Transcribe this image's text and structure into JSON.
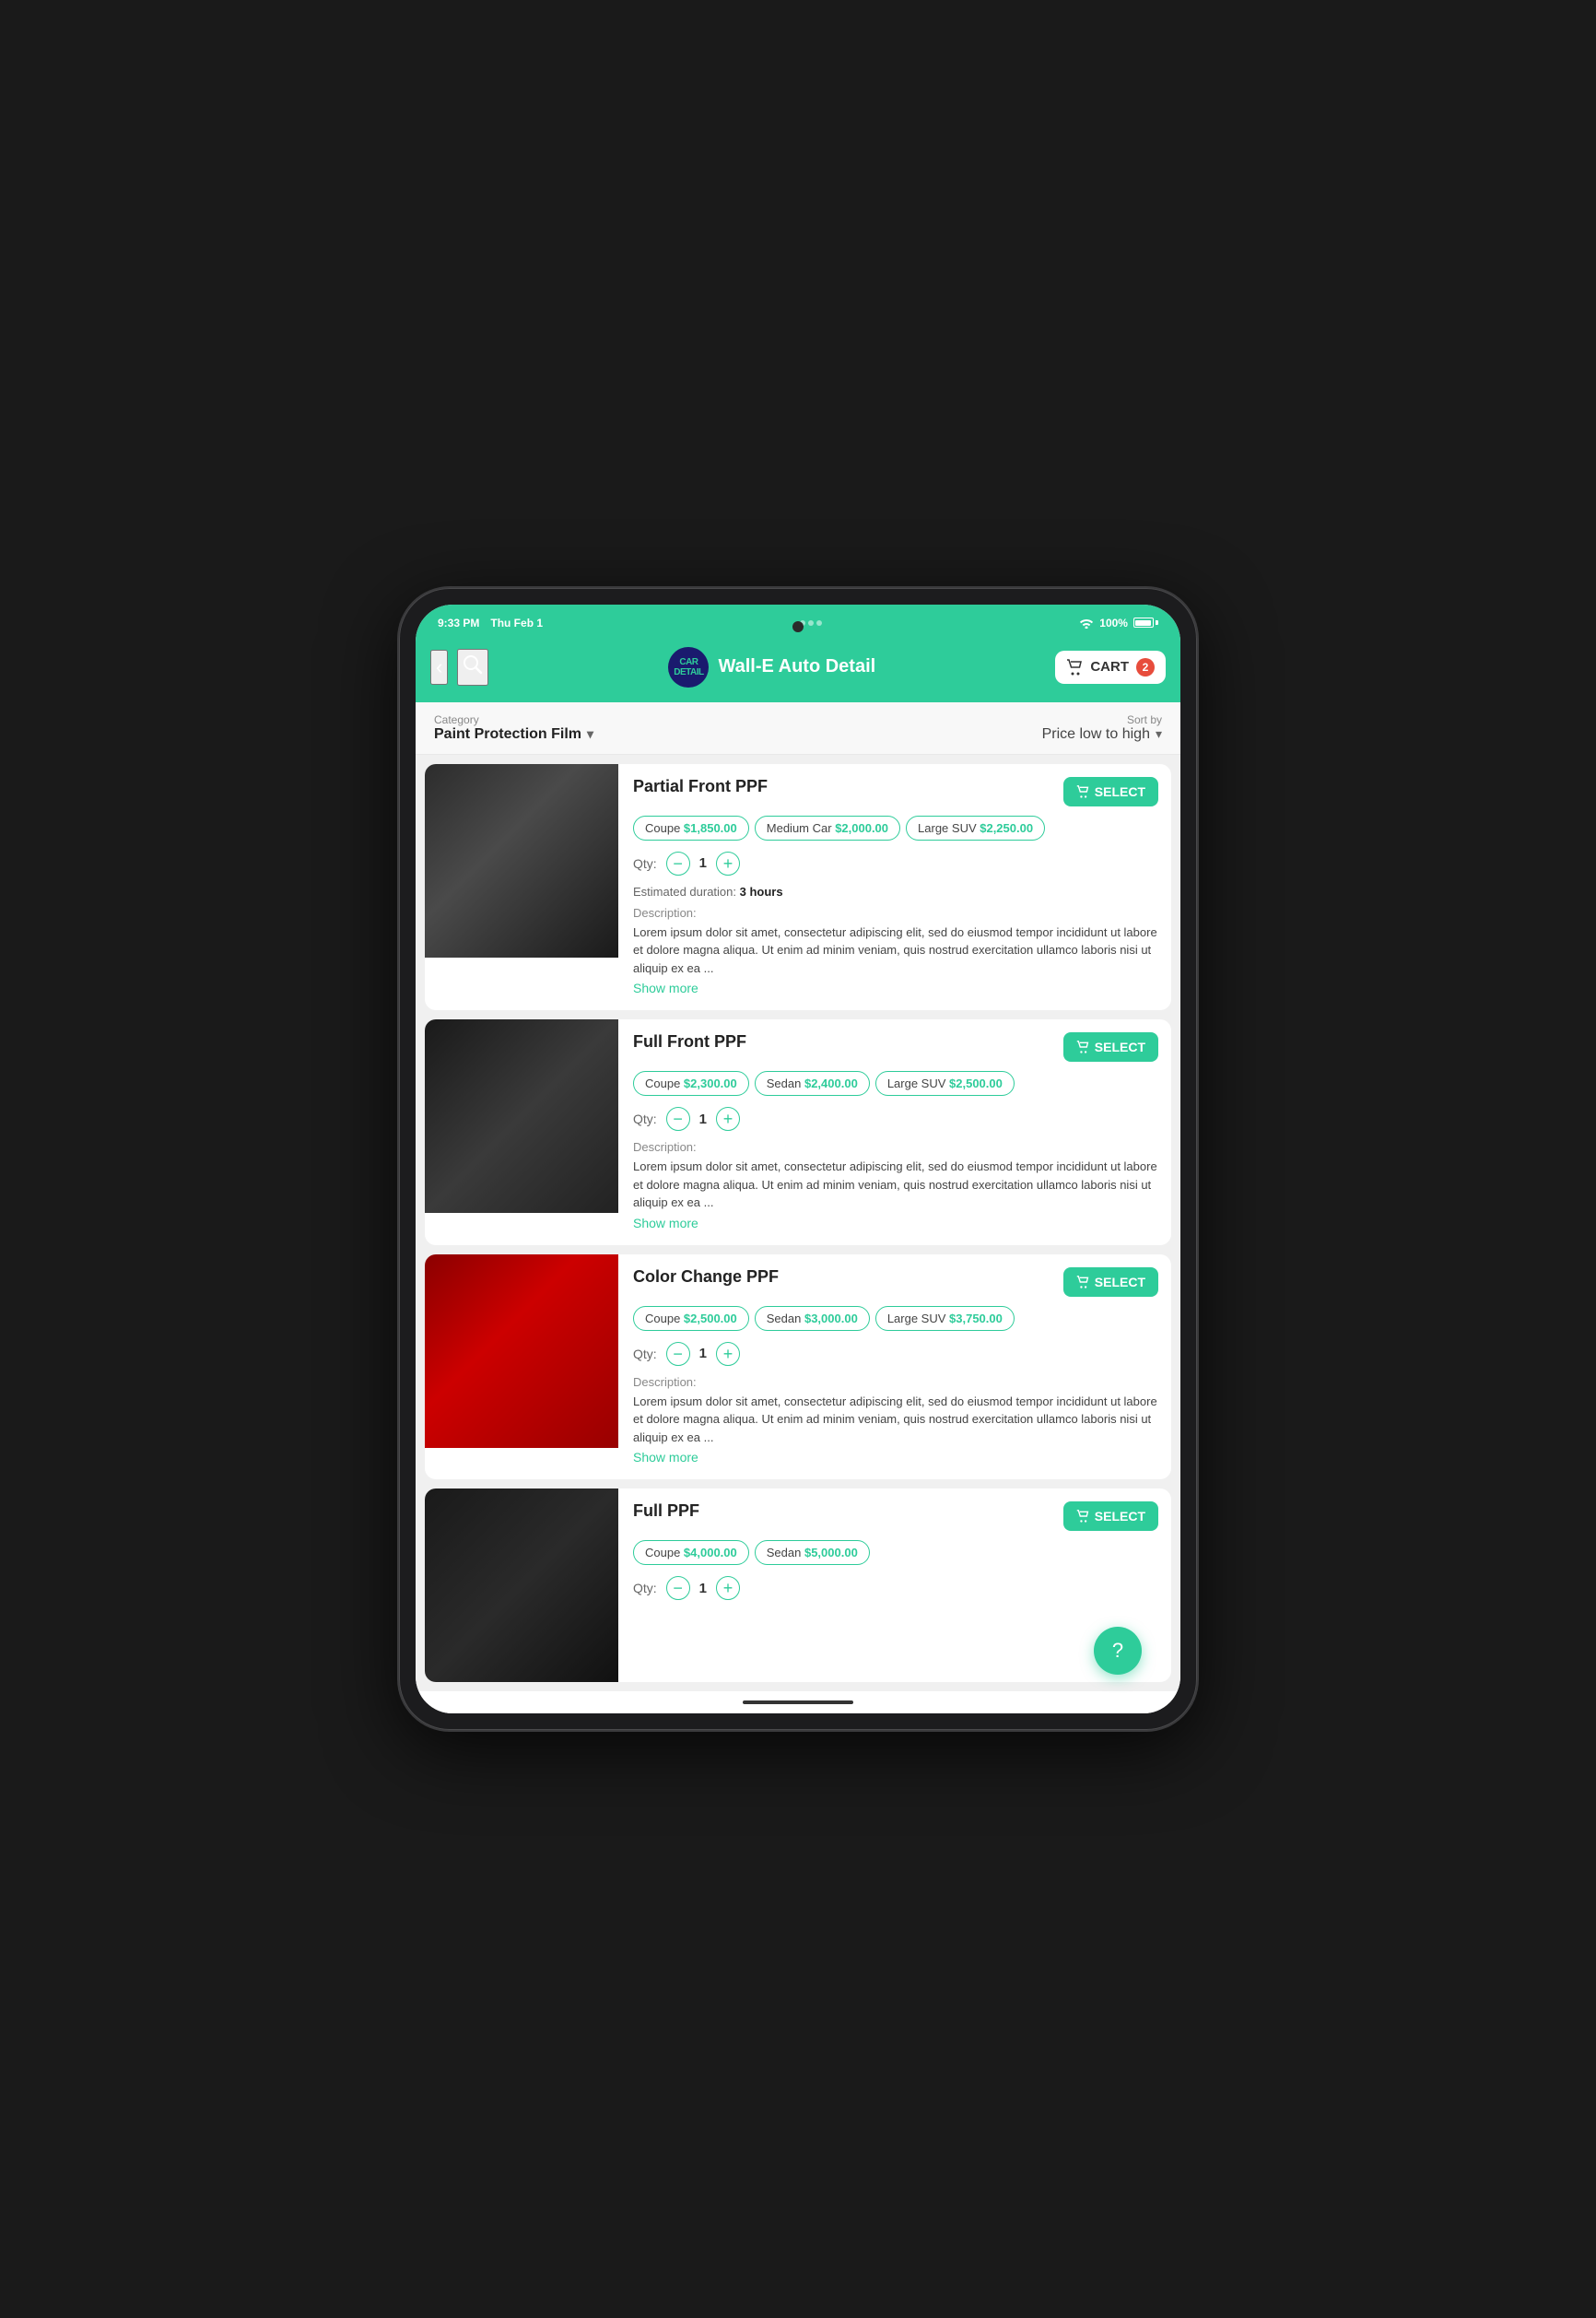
{
  "status_bar": {
    "time": "9:33 PM",
    "date": "Thu Feb 1",
    "wifi": "WiFi",
    "battery": "100%"
  },
  "header": {
    "back_label": "‹",
    "search_label": "⌕",
    "brand_name": "Wall-E Auto Detail",
    "brand_logo": "CAR\nDETAIL",
    "cart_label": "CART",
    "cart_count": "2"
  },
  "filter_bar": {
    "category_label": "Category",
    "category_value": "Paint Protection Film",
    "sort_label": "Sort by",
    "sort_value": "Price low to high"
  },
  "products": [
    {
      "id": "partial-front-ppf",
      "name": "Partial Front PPF",
      "select_label": "SELECT",
      "price_options": [
        {
          "label": "Coupe",
          "price": "$1,850.00"
        },
        {
          "label": "Medium Car",
          "price": "$2,000.00"
        },
        {
          "label": "Large SUV",
          "price": "$2,250.00"
        }
      ],
      "qty": "1",
      "qty_label": "Qty:",
      "has_duration": true,
      "duration_label": "Estimated duration:",
      "duration_value": "3 hours",
      "desc_label": "Description:",
      "desc_text": "Lorem ipsum dolor sit amet, consectetur adipiscing elit, sed do eiusmod tempor incididunt ut labore et dolore magna aliqua. Ut enim ad minim veniam, quis nostrud exercitation ullamco laboris nisi ut aliquip ex ea ...",
      "show_more": "Show more",
      "image_class": "product-image-ppf1"
    },
    {
      "id": "full-front-ppf",
      "name": "Full Front PPF",
      "select_label": "SELECT",
      "price_options": [
        {
          "label": "Coupe",
          "price": "$2,300.00"
        },
        {
          "label": "Sedan",
          "price": "$2,400.00"
        },
        {
          "label": "Large SUV",
          "price": "$2,500.00"
        }
      ],
      "qty": "1",
      "qty_label": "Qty:",
      "has_duration": false,
      "desc_label": "Description:",
      "desc_text": "Lorem ipsum dolor sit amet, consectetur adipiscing elit, sed do eiusmod tempor incididunt ut labore et dolore magna aliqua. Ut enim ad minim veniam, quis nostrud exercitation ullamco laboris nisi ut aliquip ex ea ...",
      "show_more": "Show more",
      "image_class": "product-image-ppf2"
    },
    {
      "id": "color-change-ppf",
      "name": "Color Change PPF",
      "select_label": "SELECT",
      "price_options": [
        {
          "label": "Coupe",
          "price": "$2,500.00"
        },
        {
          "label": "Sedan",
          "price": "$3,000.00"
        },
        {
          "label": "Large SUV",
          "price": "$3,750.00"
        }
      ],
      "qty": "1",
      "qty_label": "Qty:",
      "has_duration": false,
      "desc_label": "Description:",
      "desc_text": "Lorem ipsum dolor sit amet, consectetur adipiscing elit, sed do eiusmod tempor incididunt ut labore et dolore magna aliqua. Ut enim ad minim veniam, quis nostrud exercitation ullamco laboris nisi ut aliquip ex ea ...",
      "show_more": "Show more",
      "image_class": "product-image-ppf3"
    },
    {
      "id": "full-ppf",
      "name": "Full PPF",
      "select_label": "SELECT",
      "price_options": [
        {
          "label": "Coupe",
          "price": "$4,000.00"
        },
        {
          "label": "Sedan",
          "price": "$5,000.00"
        }
      ],
      "qty": "1",
      "qty_label": "Qty:",
      "has_duration": false,
      "desc_label": "Description:",
      "desc_text": "",
      "show_more": "",
      "image_class": "product-image-ppf4"
    }
  ],
  "fab": {
    "label": "?"
  }
}
